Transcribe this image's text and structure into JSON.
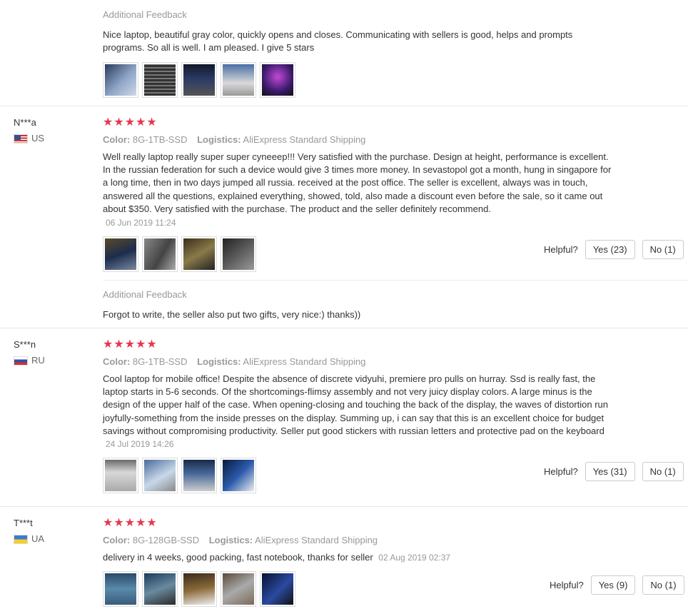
{
  "top_feedback": {
    "title": "Additional Feedback",
    "text": "Nice laptop, beautiful gray color, quickly opens and closes. Communicating with sellers is good, helps and prompts programs. So all is well. I am pleased. I give 5 stars",
    "photo_count": 5
  },
  "labels": {
    "color": "Color:",
    "logistics": "Logistics:",
    "helpful": "Helpful?",
    "additional_feedback": "Additional Feedback",
    "stars": "★★★★★"
  },
  "reviews": [
    {
      "user": "N***a",
      "country": "US",
      "rating": 5,
      "color": "8G-1TB-SSD",
      "logistics": "AliExpress Standard Shipping",
      "text": "Well really laptop really super super cyneeep!!! Very satisfied with the purchase. Design at height, performance is excellent. In the russian federation for such a device would give 3 times more money. In sevastopol got a month, hung in singapore for a long time, then in two days jumped all russia. received at the post office. The seller is excellent, always was in touch, answered all the questions, explained everything, showed, told, also made a discount even before the sale, so it came out about $350. Very satisfied with the purchase. The product and the seller definitely recommend.",
      "date": "06 Jun 2019 11:24",
      "yes": "Yes (23)",
      "no": "No (1)",
      "additional_feedback": "Forgot to write, the seller also put two gifts, very nice:) thanks))"
    },
    {
      "user": "S***n",
      "country": "RU",
      "rating": 5,
      "color": "8G-1TB-SSD",
      "logistics": "AliExpress Standard Shipping",
      "text": "Cool laptop for mobile office! Despite the absence of discrete vidyuhi, premiere pro pulls on hurray. Ssd is really fast, the laptop starts in 5-6 seconds. Of the shortcomings-flimsy assembly and not very juicy display colors. A large minus is the design of the upper half of the case. When opening-closing and touching the back of the display, the waves of distortion run joyfully-something from the inside presses on the display. Summing up, i can say that this is an excellent choice for budget savings without compromising productivity. Seller put good stickers with russian letters and protective pad on the keyboard",
      "date": "24 Jul 2019 14:26",
      "yes": "Yes (31)",
      "no": "No (1)"
    },
    {
      "user": "T***t",
      "country": "UA",
      "rating": 5,
      "color": "8G-128GB-SSD",
      "logistics": "AliExpress Standard Shipping",
      "text": "delivery in 4 weeks, good packing, fast notebook, thanks for seller",
      "date": "02 Aug 2019 02:37",
      "yes": "Yes (9)",
      "no": "No (1)"
    }
  ]
}
